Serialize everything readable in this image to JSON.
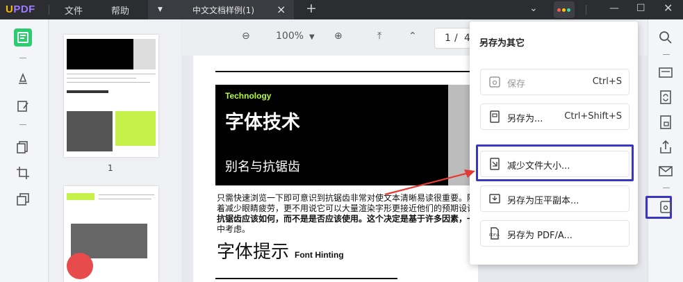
{
  "app": {
    "logo_u": "U",
    "logo_pdf": "PDF"
  },
  "menu": {
    "file": "文件",
    "help": "帮助"
  },
  "tab": {
    "title": "中文文档样例(1)"
  },
  "toolbar": {
    "zoom": "100%",
    "page_current": "1",
    "page_sep": "/",
    "page_total": "4"
  },
  "thumbnail": {
    "page_number": "1"
  },
  "document": {
    "tech_label": "Technology",
    "title": "字体技术",
    "subtitle": "别名与抗锯齿",
    "para_lines": [
      "只需快速浏览一下即可意识到抗锯齿非常对使文本清晰易读很重要。随",
      "着减少眼睛疲劳，更不用说它可以大量渲染字形更接近他们的预期设计",
      "抗锯齿应该如何，而不是是否应该使用。这个决定是基于许多因素，一",
      "中考虑。"
    ],
    "heading2": "字体提示",
    "heading2_en": "Font Hinting"
  },
  "popup": {
    "title": "另存为其它",
    "items": [
      {
        "label": "保存",
        "shortcut": "Ctrl+S",
        "icon": "save-icon"
      },
      {
        "label": "另存为...",
        "shortcut": "Ctrl+Shift+S",
        "icon": "save-as-icon"
      },
      {
        "label": "减少文件大小...",
        "shortcut": "",
        "icon": "compress-icon"
      },
      {
        "label": "另存为压平副本...",
        "shortcut": "",
        "icon": "flatten-icon"
      },
      {
        "label": "另存为 PDF/A...",
        "shortcut": "",
        "icon": "pdfa-icon"
      }
    ]
  },
  "colors": {
    "accent_green": "#2ecc71",
    "highlight_blue": "#3b36c2",
    "arrow_red": "#e53935",
    "tech_green": "#b6ff3a"
  }
}
